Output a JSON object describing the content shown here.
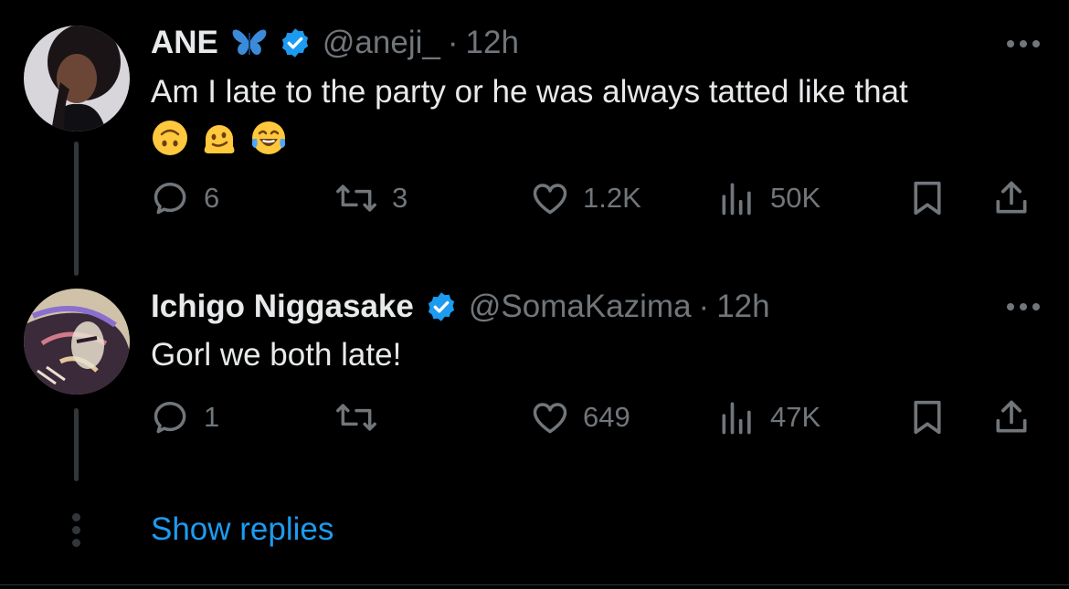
{
  "tweets": [
    {
      "name": "ANE",
      "name_emoji": "butterfly-icon",
      "handle": "@aneji_",
      "dot": "·",
      "time": "12h",
      "text": "Am I late to the party or he was always tatted like that",
      "emojis": [
        "upside-down-face",
        "melting-face",
        "face-with-tears-of-joy"
      ],
      "actions": {
        "replies": "6",
        "retweets": "3",
        "likes": "1.2K",
        "views": "50K"
      }
    },
    {
      "name": "Ichigo Niggasake",
      "handle": "@SomaKazima",
      "dot": "·",
      "time": "12h",
      "text": "Gorl we both late!",
      "actions": {
        "replies": "1",
        "retweets": "",
        "likes": "649",
        "views": "47K"
      }
    }
  ],
  "show_replies": "Show replies",
  "colors": {
    "background": "#000000",
    "primary_text": "#e7e9ea",
    "secondary_text": "#71767b",
    "accent": "#1d9bf0",
    "thread_line": "#333639"
  }
}
